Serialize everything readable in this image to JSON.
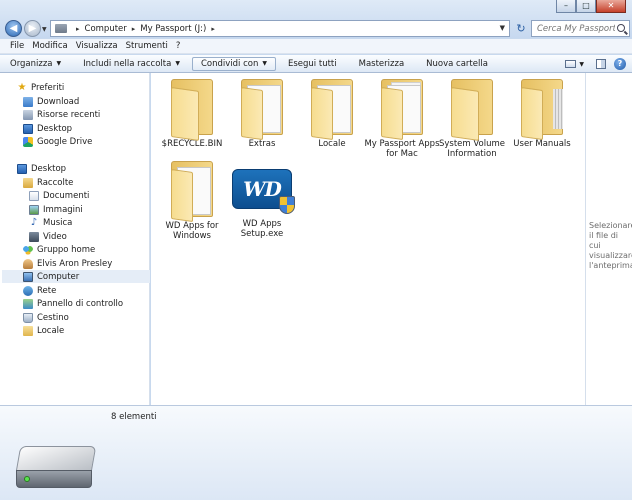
{
  "address": {
    "segments": [
      "Computer",
      "My Passport (J:)"
    ]
  },
  "search": {
    "placeholder": "Cerca My Passport (J:)"
  },
  "window_buttons": {
    "minimize": "–",
    "maximize": "□",
    "close": "✕"
  },
  "menu": [
    "File",
    "Modifica",
    "Visualizza",
    "Strumenti",
    "?"
  ],
  "commands": {
    "organize": "Organizza",
    "include": "Includi nella raccolta",
    "share": "Condividi con",
    "run_all": "Esegui tutti",
    "burn": "Masterizza",
    "new_folder": "Nuova cartella"
  },
  "nav": {
    "favorites": "Preferiti",
    "download": "Download",
    "recent": "Risorse recenti",
    "desktop_fav": "Desktop",
    "gdrive": "Google Drive",
    "desktop": "Desktop",
    "libraries": "Raccolte",
    "documents": "Documenti",
    "pictures": "Immagini",
    "music": "Musica",
    "video": "Video",
    "homegroup": "Gruppo home",
    "user": "Elvis Aron Presley",
    "computer": "Computer",
    "network": "Rete",
    "control_panel": "Pannello di controllo",
    "recycle": "Cestino",
    "local": "Locale"
  },
  "files": [
    {
      "name": "$RECYCLE.BIN",
      "type": "folder-empty"
    },
    {
      "name": "Extras",
      "type": "folder-paper"
    },
    {
      "name": "Locale",
      "type": "folder-paper"
    },
    {
      "name": "My Passport Apps for Mac",
      "type": "folder-paper"
    },
    {
      "name": "System Volume Information",
      "type": "folder-empty"
    },
    {
      "name": "User Manuals",
      "type": "folder-pages"
    },
    {
      "name": "WD Apps for Windows",
      "type": "folder-paper"
    },
    {
      "name": "WD Apps Setup.exe",
      "type": "wd-exe",
      "logo_text": "WD"
    }
  ],
  "preview_text": "Selezionare il file di cui visualizzare l'anteprima.",
  "details": {
    "count": "8 elementi"
  },
  "colors": {
    "accent": "#2c69b5",
    "folder": "#f4d88a",
    "selection": "#e5edf7"
  }
}
